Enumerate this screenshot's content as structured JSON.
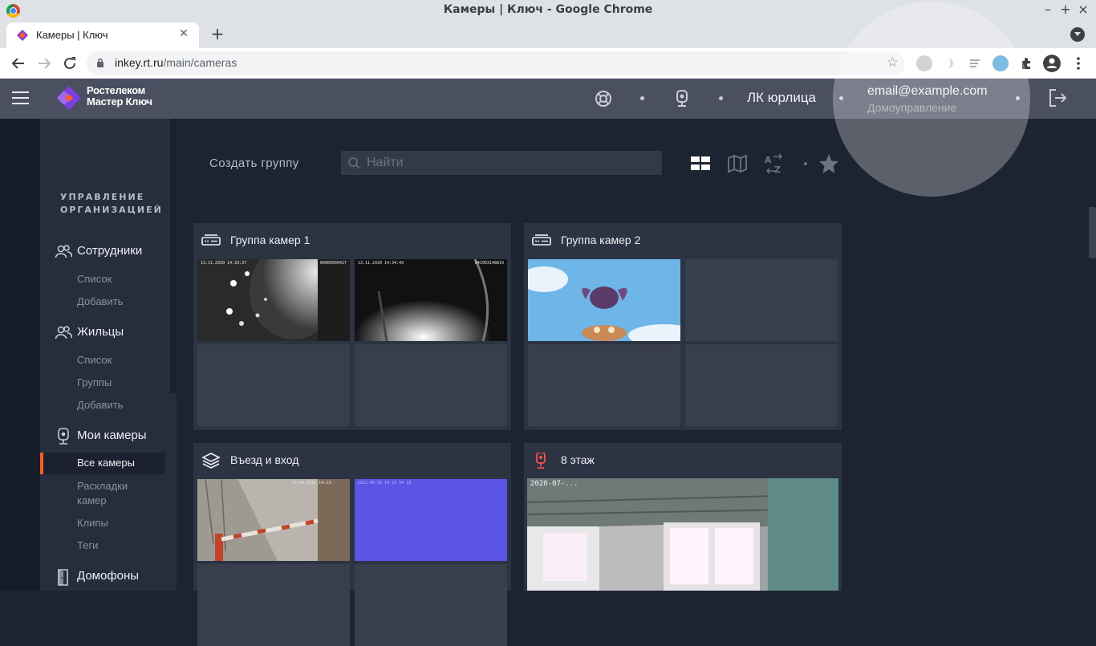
{
  "browser": {
    "window_title": "Камеры | Ключ - Google Chrome",
    "tab_title": "Камеры | Ключ",
    "url_host": "inkey.rt.ru",
    "url_path": "/main/cameras",
    "window_controls": {
      "minimize": "–",
      "maximize": "+",
      "close": "×"
    },
    "new_tab": "+",
    "tab_close": "✕"
  },
  "header": {
    "brand_line1": "Ростелеком",
    "brand_line2": "Мастер Ключ",
    "lk_label": "ЛК юрлица",
    "user_email": "email@example.com",
    "user_role": "Домоуправление"
  },
  "sidebar": {
    "section_title_line1": "УПРАВЛЕНИЕ",
    "section_title_line2": "ОРГАНИЗАЦИЕЙ",
    "groups": [
      {
        "label": "Сотрудники",
        "items": [
          "Список",
          "Добавить"
        ]
      },
      {
        "label": "Жильцы",
        "items": [
          "Список",
          "Группы",
          "Добавить"
        ]
      },
      {
        "label": "Мои камеры",
        "items": [
          "Все камеры",
          "Раскладки камер",
          "Клипы",
          "Теги"
        ]
      },
      {
        "label": "Домофоны",
        "items": []
      }
    ],
    "active_item": "Все камеры",
    "layouts_line1": "Раскладки",
    "layouts_line2": "камер"
  },
  "toolbar": {
    "create_group": "Создать группу",
    "search_placeholder": "Найти"
  },
  "cards": [
    {
      "title": "Группа камер 1",
      "icon": "dvr-icon",
      "timestamps": [
        "13.11.2020 14:33:37",
        "13.11.2020 14:34:49"
      ],
      "camera_ids": [
        "00000000427",
        "041903148819"
      ]
    },
    {
      "title": "Группа камер 2",
      "icon": "dvr-icon"
    },
    {
      "title": "Въезд и вход",
      "icon": "layers-icon",
      "timestamps": [
        "15-04-2021 14:23:",
        "2021-04-15 14 23 54 10"
      ]
    },
    {
      "title": "8 этаж",
      "icon": "camera-pin-icon",
      "timestamps": [
        "2020-07-..."
      ]
    }
  ],
  "colors": {
    "background": "#1c2331",
    "header": "#4b5060",
    "sidebar": "#262d3c",
    "card": "#2c3342",
    "accent": "#ff5a1f",
    "brand_purple": "#7b3fe4"
  }
}
